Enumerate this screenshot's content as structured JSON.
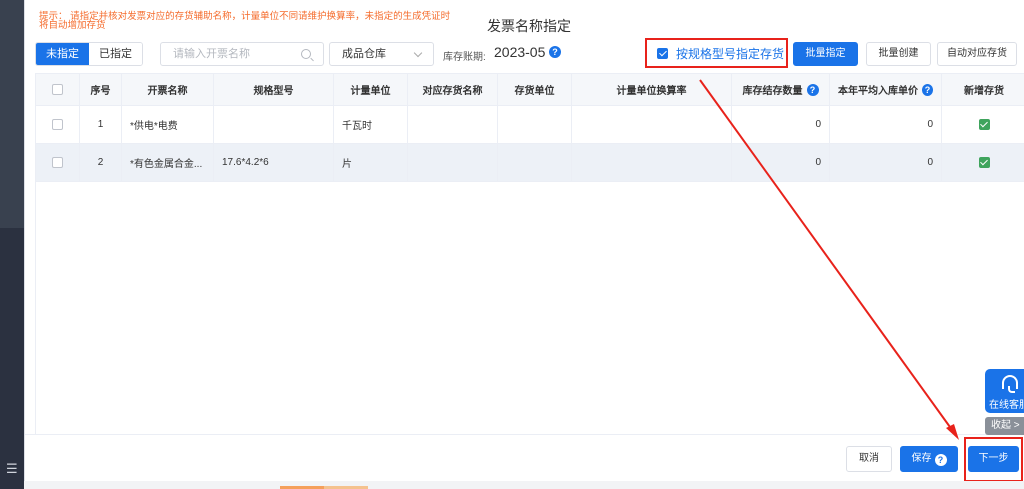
{
  "tip": "提示：  请指定并核对发票对应的存货辅助名称，计量单位不同请维护换算率，未指定的生成凭证时将自动增加存货",
  "title": "发票名称指定",
  "tabs": [
    "未指定",
    "已指定"
  ],
  "search": {
    "placeholder": "请输入开票名称"
  },
  "warehouse": "成品仓库",
  "period": {
    "label": "库存账期:",
    "value": "2023-05"
  },
  "spec_checkbox": {
    "label": "按规格型号指定存货",
    "checked": true
  },
  "toolbar": {
    "batch_assign": "批量指定",
    "batch_create": "批量创建",
    "auto_match": "自动对应存货"
  },
  "table": {
    "headers": [
      "序号",
      "开票名称",
      "规格型号",
      "计量单位",
      "对应存货名称",
      "存货单位",
      "计量单位换算率",
      "库存结存数量",
      "本年平均入库单价",
      "新增存货"
    ],
    "rows": [
      [
        "1",
        "*供电*电费",
        "",
        "千瓦时",
        "",
        "",
        "",
        "0",
        "0",
        ""
      ],
      [
        "2",
        "*有色金属合金...",
        "17.6*4.2*6",
        "片",
        "",
        "",
        "",
        "0",
        "0",
        ""
      ]
    ]
  },
  "footer": {
    "cancel": "取消",
    "save": "保存",
    "next": "下一步"
  },
  "side": {
    "cs_label": "在线客服",
    "collapse": "收起 >"
  },
  "left_menu_icon": "☰",
  "colors": {
    "primary": "#1a73e8",
    "highlight": "#e8221b",
    "tip": "#f56c2d",
    "check_green": "#3fa45d"
  }
}
